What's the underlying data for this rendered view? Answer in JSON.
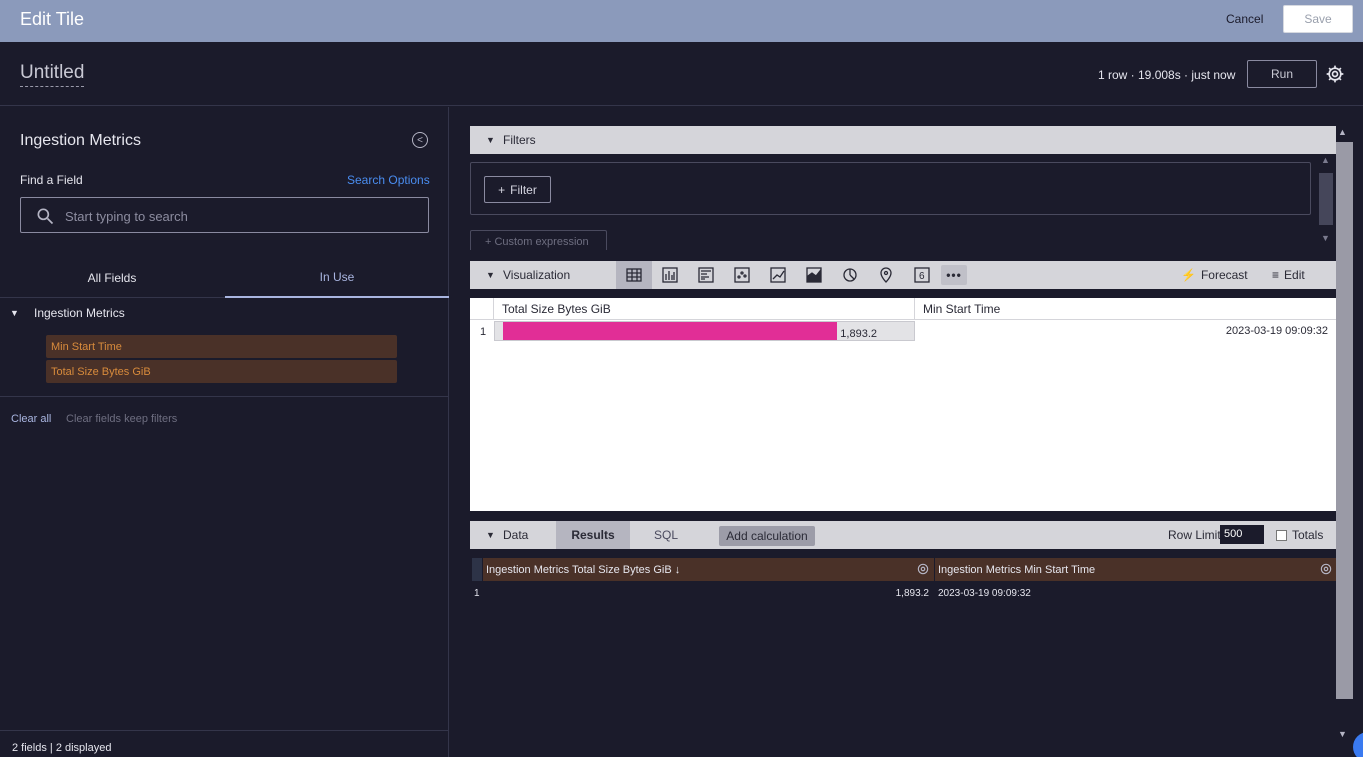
{
  "topbar": {
    "title": "Edit Tile",
    "cancel": "Cancel",
    "save": "Save"
  },
  "header": {
    "tile_name": "Untitled",
    "status": "1 row · 19.008s · just now",
    "run": "Run",
    "settings_icon": "gear-icon"
  },
  "left": {
    "explore_title": "Ingestion Metrics",
    "find_label": "Find a Field",
    "search_options": "Search Options",
    "search_placeholder": "Start typing to search",
    "tabs": [
      "All Fields",
      "In Use"
    ],
    "view_label": "Ingestion Metrics",
    "fields": [
      "Min Start Time",
      "Total Size Bytes GiB"
    ],
    "clear_all": "Clear all",
    "clear_keep": "Clear fields keep filters",
    "footer": "2 fields | 2 displayed"
  },
  "filters": {
    "label": "Filters",
    "filter_button": "Filter",
    "custom_expression": "Custom expression"
  },
  "visualization": {
    "label": "Visualization",
    "forecast": "Forecast",
    "edit": "Edit",
    "table": {
      "columns": [
        "Total Size Bytes GiB",
        "Min Start Time"
      ],
      "rows": [
        {
          "n": "1",
          "value": "1,893.2",
          "time": "2023-03-19 09:09:32",
          "bar_fraction": 0.81
        }
      ]
    }
  },
  "data": {
    "label": "Data",
    "tab_results": "Results",
    "tab_sql": "SQL",
    "add_calc": "Add calculation",
    "row_limit_label": "Row Limit",
    "row_limit_value": "500",
    "totals": "Totals",
    "columns": [
      "Ingestion Metrics Total Size Bytes GiB",
      "Ingestion Metrics Min Start Time"
    ],
    "rows": [
      {
        "n": "1",
        "v1": "1,893.2",
        "v2": "2023-03-19 09:09:32"
      }
    ]
  },
  "colors": {
    "topbar": "#8b9abb",
    "bar": "#e12e96",
    "field_bg": "#4a3128",
    "field_text": "#d88b3c",
    "link": "#4a8df0"
  }
}
